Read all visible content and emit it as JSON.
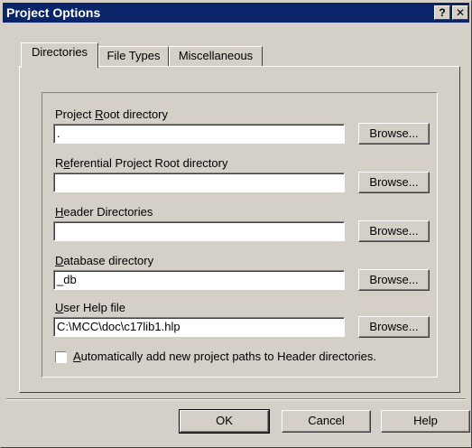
{
  "window": {
    "title": "Project Options",
    "help_button": "?",
    "close_button": "✕"
  },
  "tabs": [
    {
      "label": "Directories",
      "active": true
    },
    {
      "label": "File Types",
      "active": false
    },
    {
      "label": "Miscellaneous",
      "active": false
    }
  ],
  "fields": {
    "project_root": {
      "label_pre": "Project ",
      "label_ul": "R",
      "label_post": "oot directory",
      "value": ".",
      "browse": "Browse..."
    },
    "referential_root": {
      "label_pre": "R",
      "label_ul": "e",
      "label_post": "ferential Project Root directory",
      "value": "",
      "browse": "Browse..."
    },
    "header_dirs": {
      "label_pre": "",
      "label_ul": "H",
      "label_post": "eader Directories",
      "value": "",
      "browse": "Browse..."
    },
    "database_dir": {
      "label_pre": "",
      "label_ul": "D",
      "label_post": "atabase directory",
      "value": "_db",
      "browse": "Browse..."
    },
    "user_help": {
      "label_pre": "",
      "label_ul": "U",
      "label_post": "ser Help file",
      "value": "C:\\MCC\\doc\\c17lib1.hlp",
      "browse": "Browse..."
    }
  },
  "checkbox": {
    "label_ul": "A",
    "label_post": "utomatically add new project paths to Header directories.",
    "checked": false
  },
  "footer": {
    "ok": "OK",
    "cancel": "Cancel",
    "help": "Help"
  }
}
